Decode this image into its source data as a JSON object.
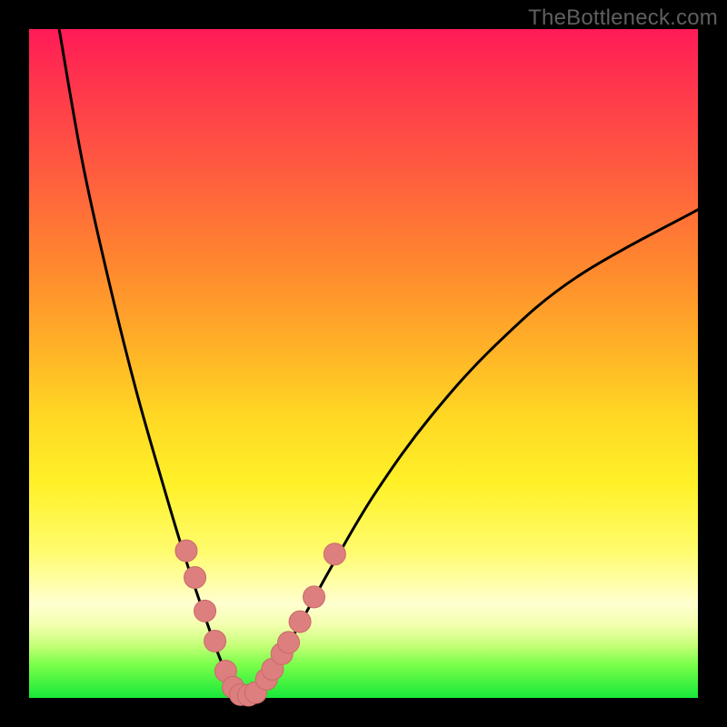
{
  "watermark": "TheBottleneck.com",
  "colors": {
    "curve": "#000000",
    "marker_fill": "#dd7f7e",
    "marker_stroke": "#c96a69",
    "background_top": "#ff1a58",
    "background_bottom": "#17e83a"
  },
  "chart_data": {
    "type": "line",
    "title": "",
    "xlabel": "",
    "ylabel": "",
    "xlim": [
      0,
      100
    ],
    "ylim": [
      0,
      100
    ],
    "curve": {
      "left_branch": [
        {
          "x": 4.5,
          "y": 100
        },
        {
          "x": 8,
          "y": 80
        },
        {
          "x": 12,
          "y": 62
        },
        {
          "x": 16,
          "y": 46
        },
        {
          "x": 20,
          "y": 32
        },
        {
          "x": 23,
          "y": 22
        },
        {
          "x": 26,
          "y": 13
        },
        {
          "x": 28.5,
          "y": 6
        },
        {
          "x": 30.5,
          "y": 1.5
        },
        {
          "x": 32,
          "y": 0
        }
      ],
      "right_branch": [
        {
          "x": 32,
          "y": 0
        },
        {
          "x": 34,
          "y": 1
        },
        {
          "x": 37,
          "y": 5
        },
        {
          "x": 41,
          "y": 12
        },
        {
          "x": 46,
          "y": 21
        },
        {
          "x": 52,
          "y": 31
        },
        {
          "x": 60,
          "y": 42
        },
        {
          "x": 70,
          "y": 53
        },
        {
          "x": 82,
          "y": 63
        },
        {
          "x": 100,
          "y": 73
        }
      ]
    },
    "markers": [
      {
        "x": 23.5,
        "y": 22
      },
      {
        "x": 24.8,
        "y": 18
      },
      {
        "x": 26.3,
        "y": 13
      },
      {
        "x": 27.8,
        "y": 8.5
      },
      {
        "x": 29.4,
        "y": 4
      },
      {
        "x": 30.5,
        "y": 1.6
      },
      {
        "x": 31.6,
        "y": 0.5
      },
      {
        "x": 32.8,
        "y": 0.4
      },
      {
        "x": 33.9,
        "y": 0.8
      },
      {
        "x": 35.5,
        "y": 2.8
      },
      {
        "x": 36.4,
        "y": 4.3
      },
      {
        "x": 37.8,
        "y": 6.6
      },
      {
        "x": 38.8,
        "y": 8.3
      },
      {
        "x": 40.5,
        "y": 11.4
      },
      {
        "x": 42.6,
        "y": 15.1
      },
      {
        "x": 45.7,
        "y": 21.5
      }
    ],
    "marker_radius": 12
  }
}
